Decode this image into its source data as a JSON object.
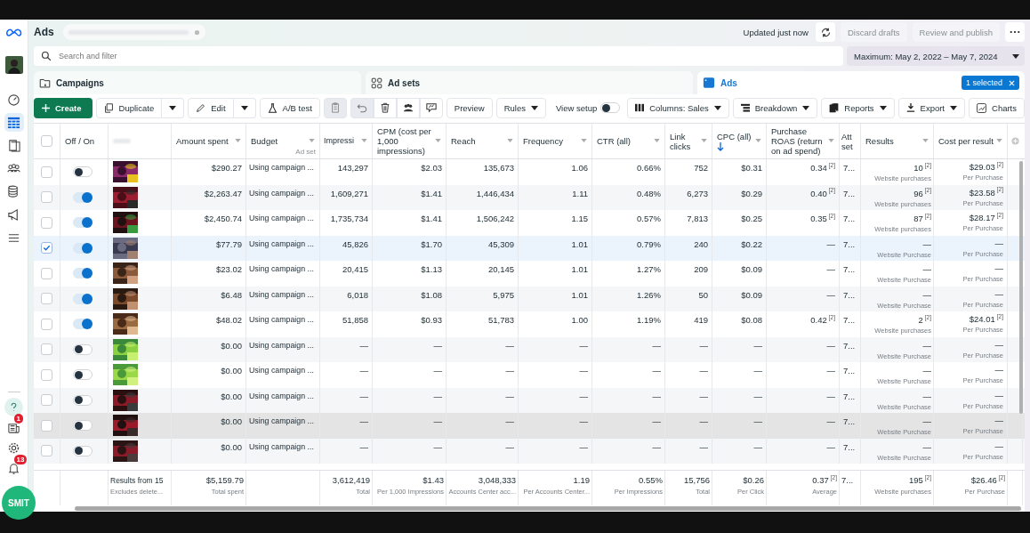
{
  "app": {
    "title": "Ads"
  },
  "header": {
    "status": "Updated just now",
    "buttons": [
      {
        "label": "Discard drafts",
        "disabled": true
      },
      {
        "label": "Review and publish",
        "disabled": true
      }
    ]
  },
  "sidebar": {
    "nav": [
      {
        "selected": false
      },
      {
        "selected": true
      },
      {
        "selected": false
      },
      {
        "selected": false
      },
      {
        "selected": false
      },
      {
        "selected": false
      },
      {
        "selected": false
      }
    ],
    "news_badge": "1",
    "alerts_badge": "13",
    "assistant": "SMIT"
  },
  "search": {
    "placeholder": "Search and filter"
  },
  "date_range": {
    "label": "Maximum: May 2, 2022 – May 7, 2024"
  },
  "levels": [
    {
      "label": "Campaigns",
      "selected": false
    },
    {
      "label": "Ad sets",
      "selected": false
    },
    {
      "label": "Ads",
      "selected": true,
      "badge": "1 selected"
    }
  ],
  "toolbar": {
    "create": "Create",
    "duplicate": "Duplicate",
    "edit": "Edit",
    "ab_test": "A/B test",
    "preview": "Preview",
    "rules": "Rules",
    "view_setup": {
      "label": "View setup",
      "on": false
    },
    "columns": "Columns: Sales",
    "breakdown": "Breakdown",
    "reports": "Reports",
    "export": "Export",
    "charts": "Charts"
  },
  "table": {
    "all_selected": false,
    "toggle_header": "Off / On",
    "columns": [
      {
        "label": "Amount spent",
        "sorted": false
      },
      {
        "label": "Budget",
        "sub": "Ad set",
        "sorted": false
      },
      {
        "label": "Impressi",
        "sorted": false
      },
      {
        "label": "CPM (cost per 1,000 impressions)",
        "sorted": false
      },
      {
        "label": "Reach",
        "sorted": false
      },
      {
        "label": "Frequency",
        "sorted": false
      },
      {
        "label": "CTR (all)",
        "sorted": false
      },
      {
        "label": "Link clicks",
        "sorted": false
      },
      {
        "label": "CPC (all)",
        "sorted": true
      },
      {
        "label": "Purchase ROAS (return on ad spend)",
        "sorted": false
      },
      {
        "label": "Att set",
        "sorted": false
      },
      {
        "label": "Results",
        "sorted": false
      },
      {
        "label": "Cost per result",
        "sorted": false
      }
    ],
    "rows": [
      {
        "selected": false,
        "on": false,
        "hovered": false,
        "cells": [
          "$290.27",
          "Using campaign ...",
          "143,297",
          "$2.03",
          "135,673",
          "1.06",
          "0.66%",
          "752",
          "$0.31",
          "0.34$^{[2]}$",
          "7..."
        ],
        "results": {
          "value": "10$^{[2]}$",
          "sub": "Website purchases"
        },
        "cost": {
          "value": "$29.03$^{[2]}$",
          "sub": "Per Purchase"
        }
      },
      {
        "selected": false,
        "on": true,
        "hovered": false,
        "cells": [
          "$2,263.47",
          "Using campaign ...",
          "1,609,271",
          "$1.41",
          "1,446,434",
          "1.11",
          "0.48%",
          "6,273",
          "$0.29",
          "0.40$^{[2]}$",
          "7..."
        ],
        "results": {
          "value": "96$^{[2]}$",
          "sub": "Website purchases"
        },
        "cost": {
          "value": "$23.58$^{[2]}$",
          "sub": "Per Purchase"
        }
      },
      {
        "selected": false,
        "on": true,
        "hovered": false,
        "cells": [
          "$2,450.74",
          "Using campaign ...",
          "1,735,734",
          "$1.41",
          "1,506,242",
          "1.15",
          "0.57%",
          "7,813",
          "$0.25",
          "0.35$^{[2]}$",
          "7..."
        ],
        "results": {
          "value": "87$^{[2]}$",
          "sub": "Website purchases"
        },
        "cost": {
          "value": "$28.17$^{[2]}$",
          "sub": "Per Purchase"
        }
      },
      {
        "selected": true,
        "on": true,
        "hovered": false,
        "cells": [
          "$77.79",
          "Using campaign ...",
          "45,826",
          "$1.70",
          "45,309",
          "1.01",
          "0.79%",
          "240",
          "$0.22",
          "—",
          "7..."
        ],
        "results": {
          "value": "—",
          "sub": "Website Purchase"
        },
        "cost": {
          "value": "—",
          "sub": "Per Purchase"
        }
      },
      {
        "selected": false,
        "on": true,
        "hovered": false,
        "cells": [
          "$23.02",
          "Using campaign ...",
          "20,415",
          "$1.13",
          "20,145",
          "1.01",
          "1.27%",
          "209",
          "$0.09",
          "—",
          "7..."
        ],
        "results": {
          "value": "—",
          "sub": "Website Purchase"
        },
        "cost": {
          "value": "—",
          "sub": "Per Purchase"
        }
      },
      {
        "selected": false,
        "on": true,
        "hovered": false,
        "cells": [
          "$6.48",
          "Using campaign ...",
          "6,018",
          "$1.08",
          "5,975",
          "1.01",
          "1.26%",
          "50",
          "$0.09",
          "—",
          "7..."
        ],
        "results": {
          "value": "—",
          "sub": "Website Purchase"
        },
        "cost": {
          "value": "—",
          "sub": "Per Purchase"
        }
      },
      {
        "selected": false,
        "on": true,
        "hovered": false,
        "cells": [
          "$48.02",
          "Using campaign ...",
          "51,858",
          "$0.93",
          "51,783",
          "1.00",
          "1.19%",
          "419",
          "$0.08",
          "0.42$^{[2]}$",
          "7..."
        ],
        "results": {
          "value": "2$^{[2]}$",
          "sub": "Website purchases"
        },
        "cost": {
          "value": "$24.01$^{[2]}$",
          "sub": "Per Purchase"
        }
      },
      {
        "selected": false,
        "on": false,
        "hovered": false,
        "cells": [
          "$0.00",
          "Using campaign ...",
          "—",
          "—",
          "—",
          "—",
          "—",
          "—",
          "—",
          "—",
          "7..."
        ],
        "results": {
          "value": "—",
          "sub": "Website Purchase"
        },
        "cost": {
          "value": "—",
          "sub": "Per Purchase"
        }
      },
      {
        "selected": false,
        "on": false,
        "hovered": false,
        "cells": [
          "$0.00",
          "Using campaign ...",
          "—",
          "—",
          "—",
          "—",
          "—",
          "—",
          "—",
          "—",
          "7..."
        ],
        "results": {
          "value": "—",
          "sub": "Website Purchase"
        },
        "cost": {
          "value": "—",
          "sub": "Per Purchase"
        }
      },
      {
        "selected": false,
        "on": false,
        "hovered": false,
        "cells": [
          "$0.00",
          "Using campaign ...",
          "—",
          "—",
          "—",
          "—",
          "—",
          "—",
          "—",
          "—",
          "7..."
        ],
        "results": {
          "value": "—",
          "sub": "Website Purchase"
        },
        "cost": {
          "value": "—",
          "sub": "Per Purchase"
        }
      },
      {
        "selected": false,
        "on": false,
        "hovered": true,
        "cells": [
          "$0.00",
          "Using campaign ...",
          "—",
          "—",
          "—",
          "—",
          "—",
          "—",
          "—",
          "—",
          "7..."
        ],
        "results": {
          "value": "—",
          "sub": "Website Purchase"
        },
        "cost": {
          "value": "—",
          "sub": "Per Purchase"
        }
      },
      {
        "selected": false,
        "on": false,
        "hovered": false,
        "cells": [
          "$0.00",
          "Using campaign ...",
          "—",
          "—",
          "—",
          "—",
          "—",
          "—",
          "—",
          "—",
          "7..."
        ],
        "results": {
          "value": "—",
          "sub": "Website Purchase"
        },
        "cost": {
          "value": "—",
          "sub": "Per Purchase"
        }
      }
    ],
    "summary": {
      "label": "Results from 15",
      "note": "Excludes delete...",
      "cells": [
        {
          "value": "$5,159.79",
          "sub": "Total spent"
        },
        null,
        {
          "value": "3,612,419",
          "sub": "Total"
        },
        {
          "value": "$1.43",
          "sub": "Per 1,000 Impressions"
        },
        {
          "value": "3,048,333",
          "sub": "Accounts Center acc..."
        },
        {
          "value": "1.19",
          "sub": "Per Accounts Center..."
        },
        {
          "value": "0.55%",
          "sub": "Per Impressions"
        },
        {
          "value": "15,756",
          "sub": "Total"
        },
        {
          "value": "$0.26",
          "sub": "Per Click"
        },
        {
          "value": "0.37$^{[2]}$",
          "sub": "Average"
        },
        {
          "value": "7..."
        },
        {
          "value": "195$^{[2]}$",
          "sub": "Website purchases"
        },
        {
          "value": "$26.46$^{[2]}$",
          "sub": "Per Purchase"
        }
      ]
    }
  }
}
